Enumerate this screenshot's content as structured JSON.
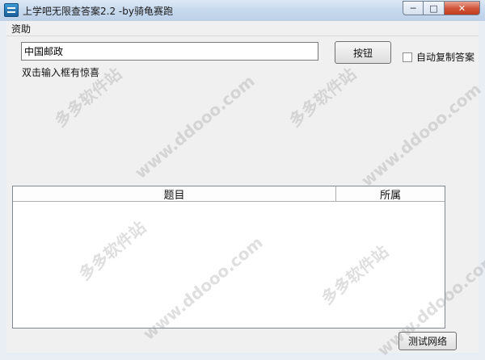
{
  "window": {
    "title": "上学吧无限查答案2.2 -by骑龟赛跑",
    "controls": {
      "minimize": "─",
      "maximize": "□",
      "close": "✕"
    }
  },
  "menu": {
    "items": [
      {
        "label": "资助"
      }
    ]
  },
  "search": {
    "value": "中国邮政"
  },
  "action_button": {
    "label": "按钮"
  },
  "auto_copy": {
    "label": "自动复制答案",
    "checked": false
  },
  "hint": "双击输入框有惊喜",
  "list": {
    "columns": [
      "题目",
      "所属"
    ],
    "rows": []
  },
  "test_button": {
    "label": "测试网络"
  },
  "watermarks": [
    "多多软件站",
    "www.ddooo.com"
  ]
}
